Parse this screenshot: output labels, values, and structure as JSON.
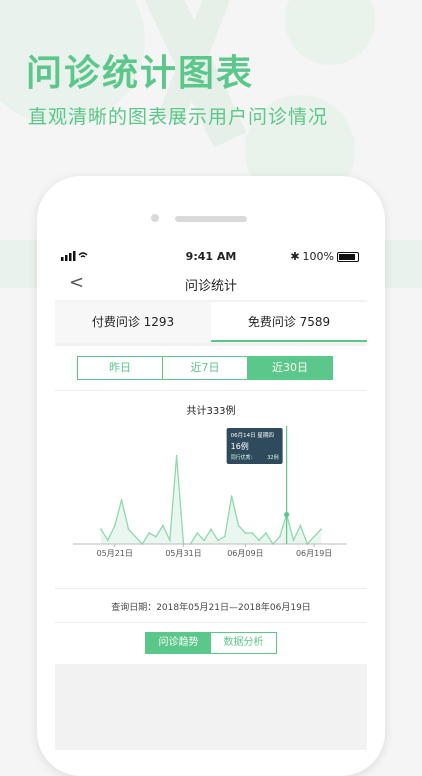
{
  "headline": "问诊统计图表",
  "subline": "直观清晰的图表展示用户问诊情况",
  "status": {
    "time": "9:41 AM",
    "battery": "100%"
  },
  "nav": {
    "back": "<",
    "title": "问诊统计"
  },
  "tabs": [
    {
      "label": "付费问诊 1293"
    },
    {
      "label": "免费问诊 7589"
    }
  ],
  "range_tabs": [
    "昨日",
    "近7日",
    "近30日"
  ],
  "bottom_tabs": [
    "问诊趋势",
    "数据分析"
  ],
  "query_text": "查询日期：2018年05月21日—2018年06月19日",
  "tooltip": {
    "date": "06月14日 星期四",
    "count": "16例",
    "peer": "同行优秀：",
    "peer_value": "32例"
  },
  "colors": {
    "accent": "#5cc78a"
  },
  "chart_data": {
    "type": "line",
    "title": "共计333例",
    "x_ticks": [
      "05月21日",
      "05月31日",
      "06月09日",
      "06月19日"
    ],
    "values": [
      4,
      1,
      5,
      12,
      4,
      2,
      0,
      3,
      2,
      5,
      1,
      24,
      0,
      0,
      3,
      1,
      4,
      1,
      2,
      13,
      5,
      3,
      3,
      1,
      3,
      0,
      2,
      8,
      1,
      5,
      0,
      2,
      4
    ]
  }
}
